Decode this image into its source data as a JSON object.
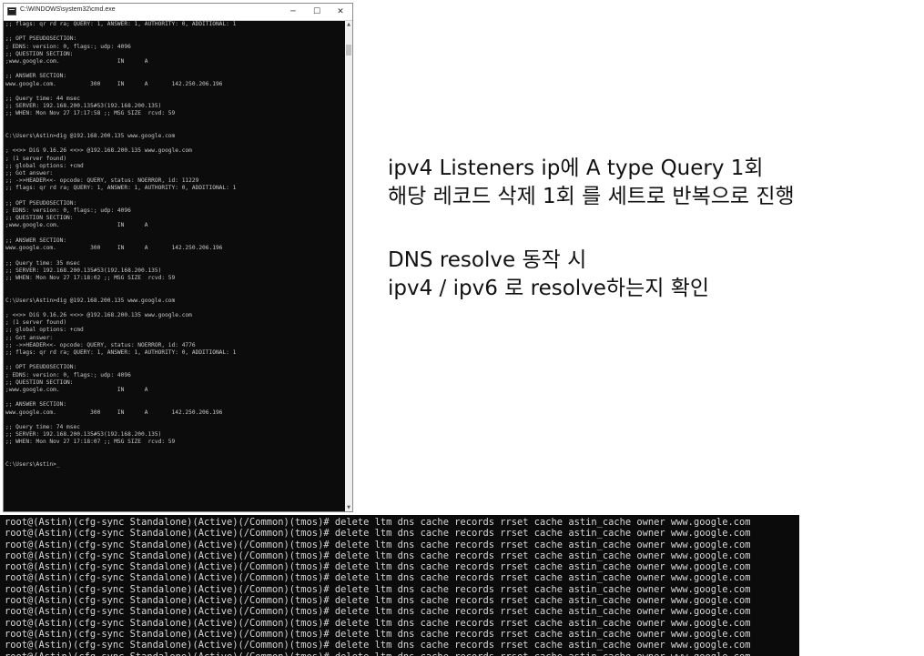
{
  "cmd_window": {
    "title": "C:\\WINDOWS\\system32\\cmd.exe",
    "buttons": {
      "minimize": "─",
      "maximize": "☐",
      "close": "✕"
    },
    "scroll": {
      "up": "▲",
      "down": "▼"
    },
    "lines": [
      ";; flags: qr rd ra; QUERY: 1, ANSWER: 1, AUTHORITY: 0, ADDITIONAL: 1",
      "",
      ";; OPT PSEUDOSECTION:",
      "; EDNS: version: 0, flags:; udp: 4096",
      ";; QUESTION SECTION:",
      ";www.google.com.                 IN      A",
      "",
      ";; ANSWER SECTION:",
      "www.google.com.          300     IN      A       142.250.206.196",
      "",
      ";; Query time: 44 msec",
      ";; SERVER: 192.168.200.135#53(192.168.200.135)",
      ";; WHEN: Mon Nov 27 17:17:58 ;; MSG SIZE  rcvd: 59",
      "",
      "",
      "C:\\Users\\Astin>dig @192.168.200.135 www.google.com",
      "",
      "; <<>> DiG 9.16.26 <<>> @192.168.200.135 www.google.com",
      "; (1 server found)",
      ";; global options: +cmd",
      ";; Got answer:",
      ";; ->>HEADER<<- opcode: QUERY, status: NOERROR, id: 11229",
      ";; flags: qr rd ra; QUERY: 1, ANSWER: 1, AUTHORITY: 0, ADDITIONAL: 1",
      "",
      ";; OPT PSEUDOSECTION:",
      "; EDNS: version: 0, flags:; udp: 4096",
      ";; QUESTION SECTION:",
      ";www.google.com.                 IN      A",
      "",
      ";; ANSWER SECTION:",
      "www.google.com.          300     IN      A       142.250.206.196",
      "",
      ";; Query time: 35 msec",
      ";; SERVER: 192.168.200.135#53(192.168.200.135)",
      ";; WHEN: Mon Nov 27 17:18:02 ;; MSG SIZE  rcvd: 59",
      "",
      "",
      "C:\\Users\\Astin>dig @192.168.200.135 www.google.com",
      "",
      "; <<>> DiG 9.16.26 <<>> @192.168.200.135 www.google.com",
      "; (1 server found)",
      ";; global options: +cmd",
      ";; Got answer:",
      ";; ->>HEADER<<- opcode: QUERY, status: NOERROR, id: 4776",
      ";; flags: qr rd ra; QUERY: 1, ANSWER: 1, AUTHORITY: 0, ADDITIONAL: 1",
      "",
      ";; OPT PSEUDOSECTION:",
      "; EDNS: version: 0, flags:; udp: 4096",
      ";; QUESTION SECTION:",
      ";www.google.com.                 IN      A",
      "",
      ";; ANSWER SECTION:",
      "www.google.com.          300     IN      A       142.250.206.196",
      "",
      ";; Query time: 74 msec",
      ";; SERVER: 192.168.200.135#53(192.168.200.135)",
      ";; WHEN: Mon Nov 27 17:18:07 ;; MSG SIZE  rcvd: 59",
      "",
      "",
      "C:\\Users\\Astin>"
    ]
  },
  "notes": {
    "line1": "ipv4 Listeners ip에 A type Query 1회",
    "line2": "해당 레코드 삭제 1회 를 세트로 반복으로 진행",
    "line3": "DNS resolve 동작 시",
    "line4": "ipv4 / ipv6 로 resolve하는지 확인"
  },
  "tmsh_terminal": {
    "lines": [
      "root@(Astin)(cfg-sync Standalone)(Active)(/Common)(tmos)# delete ltm dns cache records rrset cache astin_cache owner www.google.com",
      "root@(Astin)(cfg-sync Standalone)(Active)(/Common)(tmos)# delete ltm dns cache records rrset cache astin_cache owner www.google.com",
      "root@(Astin)(cfg-sync Standalone)(Active)(/Common)(tmos)# delete ltm dns cache records rrset cache astin_cache owner www.google.com",
      "root@(Astin)(cfg-sync Standalone)(Active)(/Common)(tmos)# delete ltm dns cache records rrset cache astin_cache owner www.google.com",
      "root@(Astin)(cfg-sync Standalone)(Active)(/Common)(tmos)# delete ltm dns cache records rrset cache astin_cache owner www.google.com",
      "root@(Astin)(cfg-sync Standalone)(Active)(/Common)(tmos)# delete ltm dns cache records rrset cache astin_cache owner www.google.com",
      "root@(Astin)(cfg-sync Standalone)(Active)(/Common)(tmos)# delete ltm dns cache records rrset cache astin_cache owner www.google.com",
      "root@(Astin)(cfg-sync Standalone)(Active)(/Common)(tmos)# delete ltm dns cache records rrset cache astin_cache owner www.google.com",
      "root@(Astin)(cfg-sync Standalone)(Active)(/Common)(tmos)# delete ltm dns cache records rrset cache astin_cache owner www.google.com",
      "root@(Astin)(cfg-sync Standalone)(Active)(/Common)(tmos)# delete ltm dns cache records rrset cache astin_cache owner www.google.com",
      "root@(Astin)(cfg-sync Standalone)(Active)(/Common)(tmos)# delete ltm dns cache records rrset cache astin_cache owner www.google.com",
      "root@(Astin)(cfg-sync Standalone)(Active)(/Common)(tmos)# delete ltm dns cache records rrset cache astin_cache owner www.google.com",
      "root@(Astin)(cfg-sync Standalone)(Active)(/Common)(tmos)# delete ltm dns cache records rrset cache astin_cache owner www.google.com"
    ]
  }
}
